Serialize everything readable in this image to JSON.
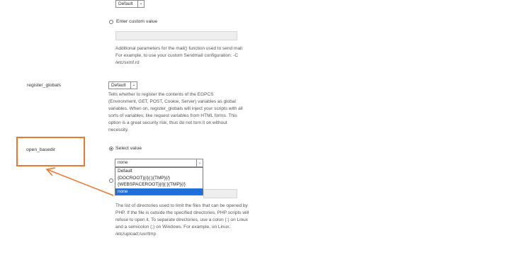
{
  "top_select": {
    "value": "Default",
    "arrow": "⌄"
  },
  "custom_value": {
    "label": "Enter custom value",
    "input_value": ""
  },
  "sendmail_help": [
    "Additional parameters for the mail() function used to send mail.",
    "For example, to use your custom Sendmail configuration: -C",
    "/etc/sxmf.rd"
  ],
  "register_globals": {
    "label": "register_globals",
    "select_value": "Default",
    "arrow": "⌄",
    "help": [
      "Tells whether to register the contents of the EGPCS",
      "(Environment, GET, POST, Cookie, Server) variables as global",
      "variables. When on, register_globals will inject your scripts with all",
      "sorts of variables, like request variables from HTML forms. This",
      "option is a great security risk, thus do not turn it on without",
      "necessity."
    ]
  },
  "open_basedir": {
    "label": "open_basedir",
    "radio_label": "Select value",
    "select_value": "none",
    "arrow": "⌄",
    "options": [
      "Default",
      "{DOCROOT}{/}{:}{TMP}{/}",
      "{WEBSPACEROOT}{/}{:}{TMP}{/}",
      "none"
    ],
    "help": [
      "The list of directories used to limit the files that can be opened by",
      "PHP. If the file is outside the specified directories, PHP scripts will",
      "refuse to open it. To separate directories, use a colon (:) on Linux",
      "and a semicolon (;) on Windows. For example, on Linux:",
      "/etc/upload:/usr/tmp"
    ]
  },
  "colors": {
    "highlight_box": "#e8792f",
    "selected_option": "#1e6fd9"
  }
}
